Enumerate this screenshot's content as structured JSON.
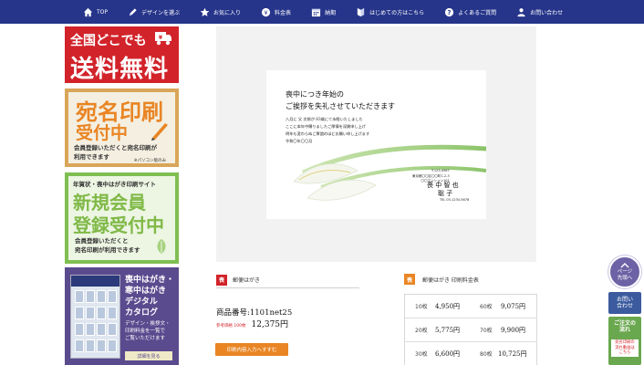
{
  "nav": {
    "items": [
      {
        "label": "TOP",
        "icon": "home-icon"
      },
      {
        "label": "デザインを選ぶ",
        "icon": "pencil-icon"
      },
      {
        "label": "お気に入り",
        "icon": "star-icon"
      },
      {
        "label": "料金表",
        "icon": "price-table-icon"
      },
      {
        "label": "納期",
        "icon": "calendar-icon"
      },
      {
        "label": "はじめての方はこちら",
        "icon": "beginner-mark-icon"
      },
      {
        "label": "よくあるご質問",
        "icon": "question-icon"
      },
      {
        "label": "お問い合わせ",
        "icon": "person-icon"
      }
    ]
  },
  "banners": {
    "free_shipping": {
      "line1": "全国どこでも",
      "line2": "送料無料"
    },
    "address_print": {
      "line1": "宛名印刷",
      "line2": "受付中",
      "line3": "会員登録いただくと宛名印刷が",
      "line4": "利用できます",
      "note": "※パソコン版のみ"
    },
    "new_member": {
      "line0": "年賀状・喪中はがき印刷サイト",
      "line1": "新規会員",
      "line2": "登録受付中",
      "line3": "会員登録いただくと",
      "line4": "宛名印刷が利用できます"
    },
    "catalog": {
      "line1": "喪中はがき・",
      "line2": "寒中はがき",
      "line3": "デジタル",
      "line4": "カタログ",
      "desc1": "デザイン・挨拶文・",
      "desc2": "印刷料金を一覧で",
      "desc3": "ご覧いただけます",
      "button": "詳細を見る"
    }
  },
  "card": {
    "heading1": "喪中につき年始の",
    "heading2": "ご挨拶を失礼させていただきます",
    "msg1": "八月に 父 次郎が 83歳にて永眠いたしました",
    "msg2": "ここに本年中賜りましたご厚情を深謝申し上げ",
    "msg3": "明年も変わらぬご厚誼のほどお願い申し上げます",
    "msg4": "令和〇年〇〇月",
    "addr1": "〒123-4567",
    "addr2": "東京都〇〇区〇〇町1-2-3",
    "addr3": "〇〇マンション101",
    "name1": "喪 中 智 也",
    "name2": "聡 子",
    "tel": "TEL 03-1234-5678"
  },
  "product": {
    "tag": "喪",
    "category": "郵便はがき",
    "number": "商品番号:1101net25",
    "ref_label": "参考価格 100枚",
    "price": "12,375円",
    "order_button": "印刷内容入力へすすむ"
  },
  "price_table": {
    "tag": "喪",
    "title": "郵便はがき 印刷料金表",
    "rows": [
      {
        "q1": "10枚",
        "p1": "4,950円",
        "q2": "60枚",
        "p2": "9,075円"
      },
      {
        "q1": "20枚",
        "p1": "5,775円",
        "q2": "70枚",
        "p2": "9,900円"
      },
      {
        "q1": "30枚",
        "p1": "6,600円",
        "q2": "80枚",
        "p2": "10,725円"
      }
    ]
  },
  "float": {
    "top": {
      "line1": "ページ",
      "line2": "先頭へ"
    },
    "inquiry": {
      "line1": "お問い",
      "line2": "合わせ"
    },
    "flow": {
      "line1": "ご注文の",
      "line2": "流れ",
      "sub1": "宛名印刷の",
      "sub2": "流れ動画は",
      "sub3": "こちら"
    }
  },
  "colors": {
    "nav_bg": "#26358a",
    "red": "#d2232a",
    "orange": "#e98524",
    "green": "#7fb947",
    "purple": "#5a4a8e"
  }
}
